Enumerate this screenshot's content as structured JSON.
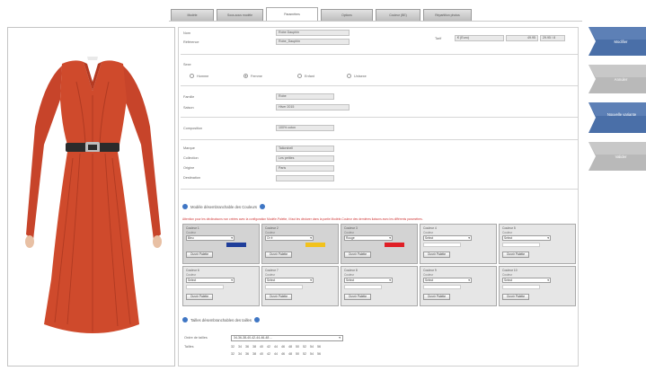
{
  "tabs": [
    {
      "label": "Modèle",
      "active": false
    },
    {
      "label": "Sous-sous modèle",
      "active": false
    },
    {
      "label": "Paramètres",
      "active": true
    },
    {
      "label": "Options",
      "active": false
    },
    {
      "label": "Couleur (BE)",
      "active": false
    },
    {
      "label": "Répartition photos",
      "active": false
    }
  ],
  "header": {
    "nom_label": "Nom",
    "nom_value": "Robe Dauphin",
    "ref_label": "Référence",
    "ref_value": "Robe_Dauphin",
    "tarif_label": "Tarif",
    "tarif_currency": "€ (Euro)",
    "tarif_amount": "49.95",
    "tarif_extra": "29.95 / 8"
  },
  "sexe": {
    "label": "Sexe",
    "options": [
      "Homme",
      "Femme",
      "Enfant",
      "Unisexe"
    ],
    "selected": "Femme"
  },
  "famille": {
    "famille_label": "Famille",
    "famille_value": "Robe",
    "saison_label": "Saison",
    "saison_value": "Hiver 2015"
  },
  "composition": {
    "label": "Composition",
    "value": "100% coton"
  },
  "marque": {
    "marque_label": "Marque",
    "marque_value": "Tailorshell",
    "collection_label": "Collection",
    "collection_value": "Les petites",
    "origine_label": "Origine",
    "origine_value": "Paris",
    "destination_label": "Destination",
    "destination_value": ""
  },
  "colors_section": {
    "title": "Modèle désembranchable des Couleurs",
    "warning": "Attention pour les déclinaisons non créées avec la configuration Modèle-Palette, il faut les déclarer dans la partie Modèle-Couleur des dernières liaisons avec les différents paramètres.",
    "sub_label": "Couleur",
    "button_label": "Ouvrir Palette",
    "boxes": [
      {
        "title": "Couleur 1",
        "select": "Bleu",
        "swatch": "#1f3e9a"
      },
      {
        "title": "Couleur 2",
        "select": "Or ë",
        "swatch": "#f2c21c"
      },
      {
        "title": "Couleur 3",
        "select": "Rouge",
        "swatch": "#e01f26"
      },
      {
        "title": "Couleur 4",
        "select": "Select",
        "swatch": ""
      },
      {
        "title": "Couleur 5",
        "select": "Select",
        "swatch": ""
      },
      {
        "title": "Couleur 6",
        "select": "Select",
        "swatch": ""
      },
      {
        "title": "Couleur 7",
        "select": "Select",
        "swatch": ""
      },
      {
        "title": "Couleur 8",
        "select": "Select",
        "swatch": ""
      },
      {
        "title": "Couleur 9",
        "select": "Select",
        "swatch": ""
      },
      {
        "title": "Couleur 10",
        "select": "Select",
        "swatch": ""
      }
    ]
  },
  "sizes_section": {
    "title": "Tailles désembranchables des tailles",
    "order_label": "Ordre de tailles",
    "order_value": "34-36-38-40-42-44-46-48 ...",
    "tailles_label": "Tailles",
    "row1": [
      "32",
      "34",
      "36",
      "38",
      "40",
      "42",
      "44",
      "46",
      "48",
      "50",
      "52",
      "54",
      "56"
    ],
    "row2": [
      "32",
      "34",
      "36",
      "38",
      "40",
      "42",
      "44",
      "46",
      "48",
      "50",
      "52",
      "54",
      "56"
    ]
  },
  "actions": [
    {
      "label": "Modifier",
      "style": "blue"
    },
    {
      "label": "Annuler",
      "style": "gray"
    },
    {
      "label": "Nouvelle variante",
      "style": "blue"
    },
    {
      "label": "Valider",
      "style": "gray"
    }
  ],
  "colors": {
    "action_blue": "#4a6fa8",
    "action_gray": "#b9b9b9",
    "dress": "#cf4a2c",
    "info_icon": "#3f76c4",
    "warning_text": "#d03a3a"
  }
}
